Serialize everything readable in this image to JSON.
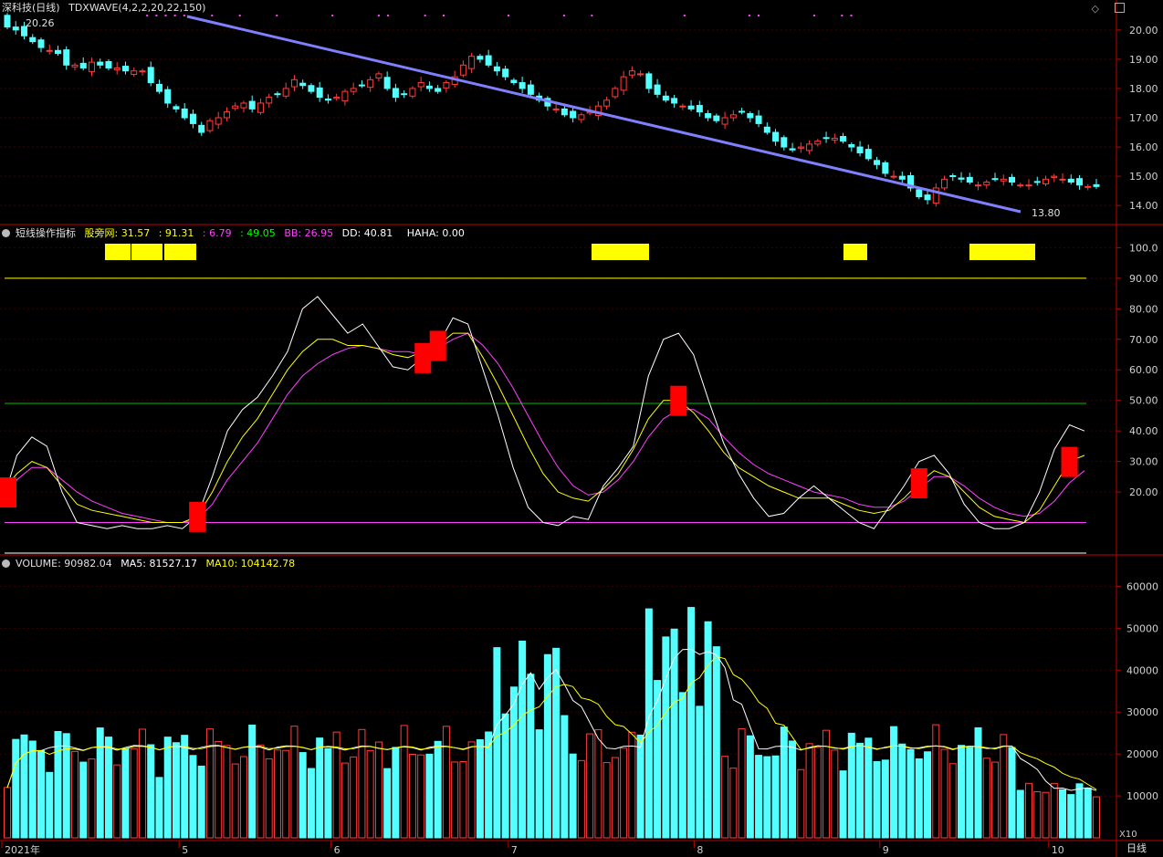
{
  "colors": {
    "up": "#ff3c3c",
    "down": "#54ffff",
    "axis": "#c00000",
    "grid": "#3a0000",
    "trend": "#8080ff",
    "yellow": "#ffff00",
    "magenta": "#ff40ff",
    "white": "#ffffff",
    "green": "#00c000"
  },
  "header": {
    "price_title": "深科技(日线)",
    "price_formula": "TDXWAVE(4,2,2,20,22,150)",
    "ind_title": "短线操作指标",
    "ind_v1_label": "股旁网: 31.57",
    "ind_v2": ": 91.31",
    "ind_v3": ": 6.79",
    "ind_v4": ": 49.05",
    "ind_bb": "BB: 26.95",
    "ind_dd": "DD: 40.81",
    "ind_haha": "HAHA: 0.00",
    "vol_label": "VOLUME: 90982.04",
    "vol_ma5": "MA5: 81527.17",
    "vol_ma10": "MA10: 104142.78"
  },
  "icons": {
    "menu": "circle-menu-icon",
    "diamond": "diamond-icon",
    "window": "window-icon"
  },
  "labels": {
    "high_price": "20.26",
    "low_price": "13.80",
    "period": "日线",
    "scale": "X10"
  },
  "chart_data": [
    {
      "type": "candlestick",
      "title": "深科技(日线)",
      "y_ticks": [
        "20.00",
        "19.00",
        "18.00",
        "17.00",
        "16.00",
        "15.00",
        "14.00"
      ],
      "ylim": [
        13.6,
        20.4
      ],
      "x_labels": [
        "2021年",
        "5",
        "6",
        "7",
        "8",
        "9",
        "10"
      ],
      "x_label_index": [
        0,
        21,
        39,
        60,
        82,
        104,
        124
      ],
      "n": 130,
      "close": [
        20.1,
        20.0,
        19.8,
        19.6,
        19.4,
        19.3,
        19.2,
        18.8,
        18.8,
        18.7,
        18.9,
        18.8,
        18.7,
        18.7,
        18.6,
        18.6,
        18.6,
        18.2,
        17.9,
        17.5,
        17.3,
        17.0,
        16.8,
        16.5,
        16.9,
        17.0,
        17.2,
        17.4,
        17.5,
        17.3,
        17.5,
        17.7,
        17.8,
        18.0,
        18.3,
        18.1,
        17.9,
        17.7,
        17.6,
        17.7,
        17.9,
        18.0,
        18.1,
        18.3,
        18.5,
        18.0,
        17.7,
        17.8,
        18.0,
        18.2,
        18.0,
        17.9,
        18.2,
        18.4,
        18.8,
        19.1,
        19.0,
        18.8,
        18.6,
        18.4,
        18.2,
        18.0,
        17.8,
        17.6,
        17.4,
        17.3,
        17.1,
        17.0,
        17.1,
        17.2,
        17.4,
        17.6,
        18.0,
        18.4,
        18.6,
        18.5,
        18.0,
        17.8,
        17.6,
        17.5,
        17.4,
        17.3,
        17.2,
        17.0,
        16.9,
        17.0,
        17.1,
        17.2,
        17.0,
        16.8,
        16.5,
        16.2,
        16.0,
        15.9,
        16.0,
        16.1,
        16.2,
        16.3,
        16.3,
        16.2,
        16.0,
        15.8,
        15.6,
        15.4,
        15.1,
        15.0,
        14.9,
        14.6,
        14.3,
        14.2,
        14.6,
        14.9,
        15.0,
        14.9,
        14.8,
        14.7,
        14.8,
        14.9,
        14.9,
        14.8,
        14.7,
        14.7,
        14.8,
        14.9,
        15.0,
        14.9,
        14.8,
        14.7,
        14.65,
        14.65
      ],
      "volume_ylim": [
        0,
        64000
      ],
      "volume_ticks": [
        "60000",
        "50000",
        "40000",
        "30000",
        "20000",
        "10000"
      ]
    },
    {
      "type": "line",
      "title": "短线操作指标",
      "y_ticks": [
        "100.0",
        "90.00",
        "80.00",
        "70.00",
        "60.00",
        "50.00",
        "40.00",
        "30.00",
        "20.00"
      ],
      "ylim": [
        0,
        104
      ],
      "levels": [
        90,
        49,
        10,
        0
      ],
      "series_white": [
        16,
        32,
        38,
        35,
        20,
        10,
        9,
        8,
        9,
        8,
        8,
        9,
        8,
        12,
        25,
        40,
        47,
        51,
        58,
        66,
        80,
        84,
        78,
        72,
        75,
        68,
        61,
        60,
        64,
        68,
        77,
        75,
        60,
        45,
        28,
        15,
        10,
        9,
        12,
        11,
        22,
        28,
        35,
        58,
        70,
        72,
        65,
        50,
        36,
        26,
        18,
        12,
        13,
        18,
        22,
        18,
        14,
        10,
        8,
        15,
        22,
        30,
        32,
        26,
        16,
        10,
        8,
        8,
        10,
        20,
        34,
        42,
        40
      ],
      "series_yellow": [
        20,
        26,
        30,
        28,
        22,
        16,
        14,
        13,
        12,
        11,
        10,
        10,
        10,
        12,
        20,
        30,
        38,
        44,
        52,
        60,
        66,
        70,
        70,
        68,
        68,
        67,
        65,
        64,
        66,
        68,
        72,
        72,
        64,
        55,
        45,
        35,
        26,
        20,
        18,
        17,
        21,
        26,
        34,
        44,
        50,
        50,
        46,
        40,
        33,
        28,
        25,
        22,
        20,
        18,
        18,
        18,
        16,
        14,
        13,
        14,
        18,
        23,
        27,
        25,
        20,
        15,
        12,
        11,
        10,
        14,
        22,
        30,
        32
      ],
      "series_magenta": [
        16,
        24,
        28,
        28,
        24,
        20,
        17,
        15,
        13,
        12,
        11,
        10,
        10,
        11,
        16,
        24,
        30,
        36,
        44,
        52,
        58,
        62,
        65,
        67,
        68,
        67,
        66,
        66,
        65,
        67,
        70,
        72,
        68,
        62,
        54,
        45,
        36,
        28,
        22,
        19,
        20,
        24,
        30,
        38,
        44,
        47,
        47,
        44,
        38,
        33,
        29,
        26,
        24,
        22,
        20,
        19,
        18,
        16,
        15,
        15,
        17,
        21,
        25,
        25,
        22,
        18,
        15,
        13,
        12,
        13,
        17,
        23,
        27
      ],
      "buy_markers": [
        0,
        13,
        45,
        61,
        71
      ],
      "sell_markers": [
        28,
        29
      ]
    },
    {
      "type": "bar",
      "title": "VOLUME",
      "ylim": [
        0,
        64000
      ]
    }
  ]
}
